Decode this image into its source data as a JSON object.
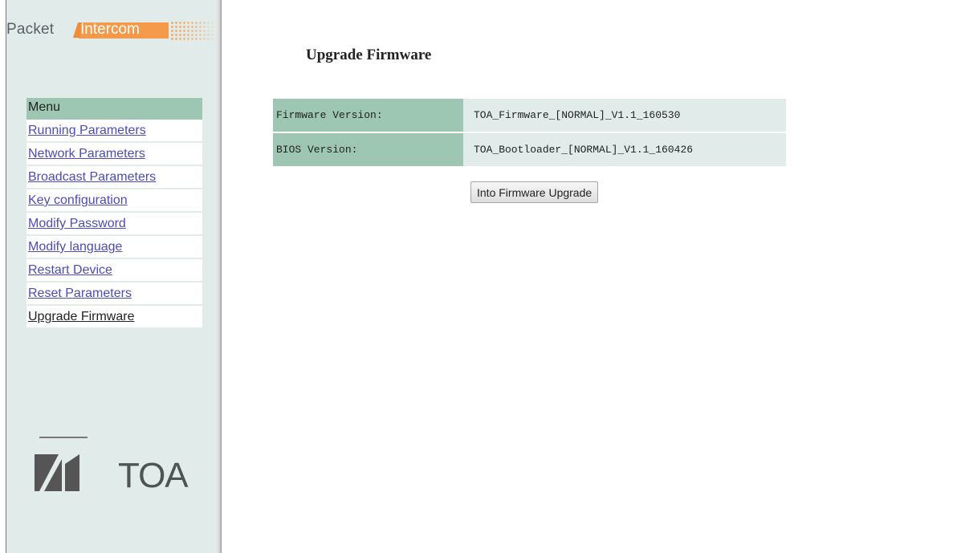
{
  "brand": {
    "packet": "Packet",
    "intercom": "Intercom",
    "toa": "TOA",
    "accent_color": "#f49a4a"
  },
  "sidebar": {
    "menu_title": "Menu",
    "items": [
      {
        "label": "Running Parameters",
        "active": false
      },
      {
        "label": "Network Parameters",
        "active": false
      },
      {
        "label": "Broadcast Parameters",
        "active": false
      },
      {
        "label": "Key configuration",
        "active": false
      },
      {
        "label": "Modify Password",
        "active": false
      },
      {
        "label": "Modify language",
        "active": false
      },
      {
        "label": "Restart Device",
        "active": false
      },
      {
        "label": "Reset Parameters",
        "active": false
      },
      {
        "label": "Upgrade Firmware",
        "active": true
      }
    ]
  },
  "main": {
    "title": "Upgrade Firmware",
    "rows": [
      {
        "label": "Firmware Version:",
        "value": "TOA_Firmware_[NORMAL]_V1.1_160530"
      },
      {
        "label": "BIOS Version:",
        "value": "TOA_Bootloader_[NORMAL]_V1.1_160426"
      }
    ],
    "upgrade_button": "Into Firmware Upgrade"
  },
  "colors": {
    "sidebar_bg": "#e1ecea",
    "header_bg": "#9dc6b3",
    "link": "#4c4bb8"
  }
}
